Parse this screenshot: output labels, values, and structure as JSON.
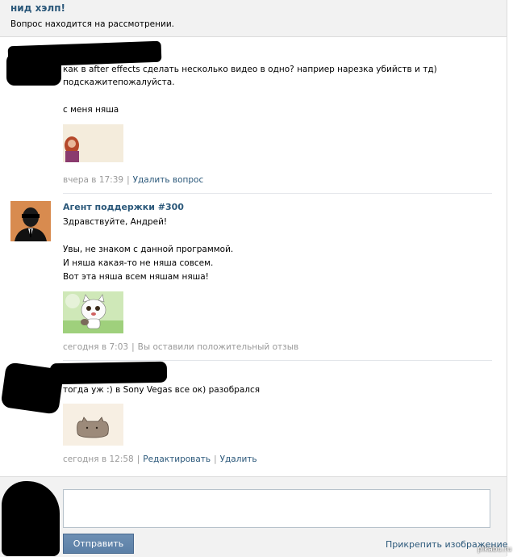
{
  "header": {
    "title": "нид хэлп!",
    "status": "Вопрос находится на рассмотрении."
  },
  "messages": [
    {
      "lines": [
        "как в after effects сделать несколько видео в одно? наприер нарезка убийств и тд)",
        "подскажитепожалуйста.",
        "с меня няша"
      ],
      "time": "вчера в 17:39",
      "actions": [
        "Удалить вопрос"
      ]
    },
    {
      "author": "Агент поддержки #300",
      "lines": [
        "Здравствуйте, Андрей!",
        "Увы, не знаком с данной программой.",
        "И няша какая-то не няша совсем.",
        "Вот эта няша всем няшам няша!"
      ],
      "time": "сегодня в 7:03",
      "actions": [
        "Вы оставили положительный отзыв"
      ]
    },
    {
      "lines": [
        "тогда уж :) в Sony Vegas все ок) разобрался"
      ],
      "time": "сегодня в 12:58",
      "actions": [
        "Редактировать",
        "Удалить"
      ]
    }
  ],
  "compose": {
    "send_label": "Отправить",
    "attach_label": "Прикрепить изображение",
    "textarea_value": ""
  },
  "watermark": "pikabu.ru",
  "colors": {
    "link": "#2b587a",
    "meta": "#999999",
    "button": "#5b7fa6",
    "panel": "#f2f2f2"
  }
}
